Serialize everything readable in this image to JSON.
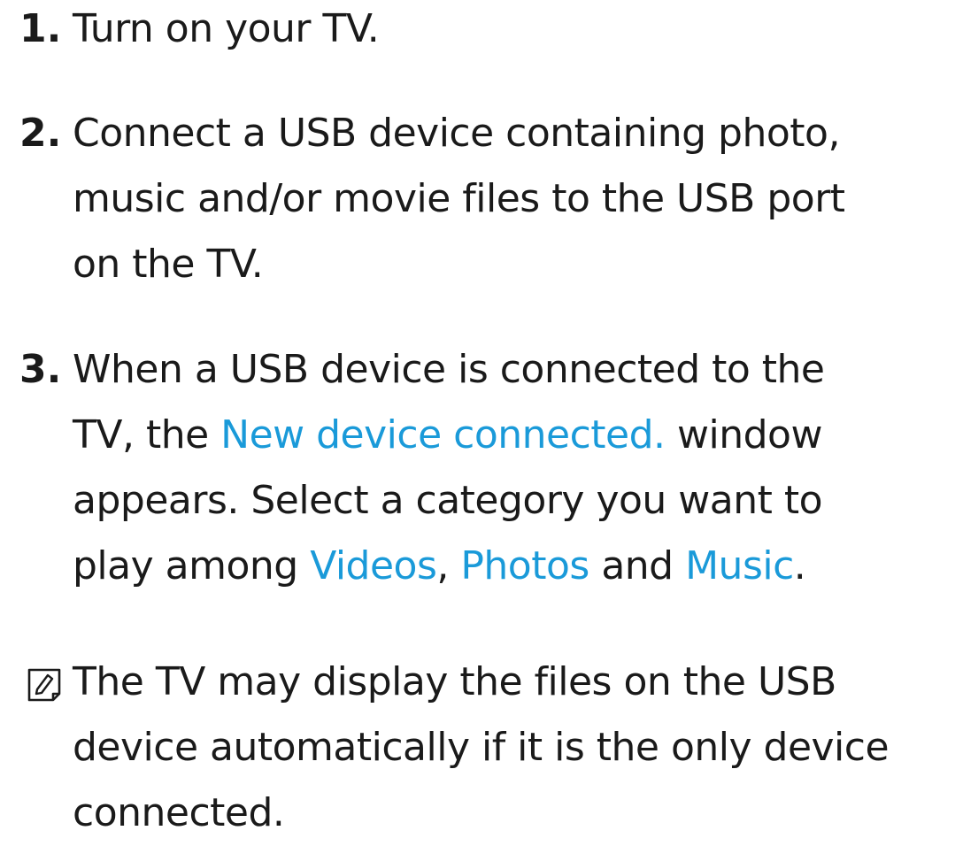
{
  "steps": [
    {
      "num": "1.",
      "lines": [
        "Turn on your TV."
      ]
    },
    {
      "num": "2.",
      "lines": [
        "Connect a USB device containing photo,",
        "music and/or movie files to the USB port",
        "on the TV."
      ]
    },
    {
      "num": "3.",
      "line1": "When a USB device is connected to the",
      "line2_pre": "TV, the ",
      "line2_hl": "New device connected.",
      "line2_post": " window",
      "line3": "appears. Select a category you want to",
      "line4_pre": "play among ",
      "line4_hl1": "Videos",
      "line4_sep1": ", ",
      "line4_hl2": "Photos",
      "line4_sep2": " and ",
      "line4_hl3": "Music",
      "line4_post": "."
    }
  ],
  "note": {
    "icon": "note-icon",
    "lines": [
      "The TV may display the files on the USB",
      "device automatically if it is the only device",
      "connected."
    ]
  },
  "colors": {
    "text": "#1a1a1a",
    "highlight": "#1a9ad9"
  }
}
